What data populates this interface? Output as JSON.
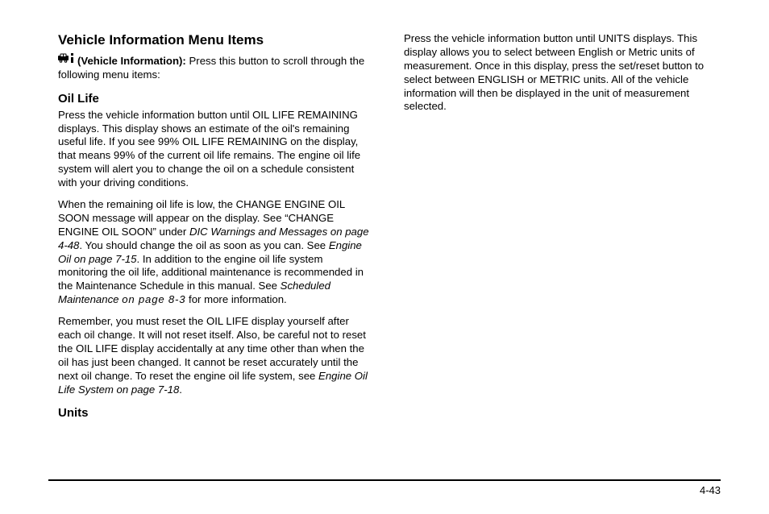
{
  "heading": "Vehicle Information Menu Items",
  "intro": {
    "icon": "vehicle-info-icon",
    "label": "(Vehicle Information):",
    "text": "Press this button to scroll through the following menu items:"
  },
  "oil_life": {
    "heading": "Oil Life",
    "p1": "Press the vehicle information button until OIL LIFE REMAINING displays. This display shows an estimate of the oil's remaining useful life. If you see 99% OIL LIFE REMAINING on the display, that means 99% of the current oil life remains. The engine oil life system will alert you to change the oil on a schedule consistent with your driving conditions.",
    "p2a": "When the remaining oil life is low, the CHANGE ENGINE OIL SOON message will appear on the display. See “CHANGE ENGINE OIL SOON” under ",
    "p2_ref1": "DIC Warnings and Messages on page 4-48",
    "p2b": ". You should change the oil as soon as you can. See ",
    "p2_ref2": "Engine Oil on page 7-15",
    "p2c": ". In addition to the engine oil life system monitoring the oil life, additional maintenance is recommended in the Maintenance Schedule in this manual. See ",
    "p2_ref3a": "Scheduled Maintenance ",
    "p2_ref3b": "on page 8-3",
    "p2d": " for more information.",
    "p3a": "Remember, you must reset the OIL LIFE display yourself after each oil change. It will not reset itself. Also, be careful not to reset the OIL LIFE display accidentally at any time other than when the oil has just been changed. It cannot be reset accurately until the next oil change. To reset the engine oil life system, see ",
    "p3_ref": "Engine Oil Life System on page 7-18",
    "p3b": "."
  },
  "units": {
    "heading": "Units",
    "p1": "Press the vehicle information button until UNITS displays. This display allows you to select between English or Metric units of measurement. Once in this display, press the set/reset button to select between ENGLISH or METRIC units. All of the vehicle information will then be displayed in the unit of measurement selected."
  },
  "page_number": "4-43"
}
